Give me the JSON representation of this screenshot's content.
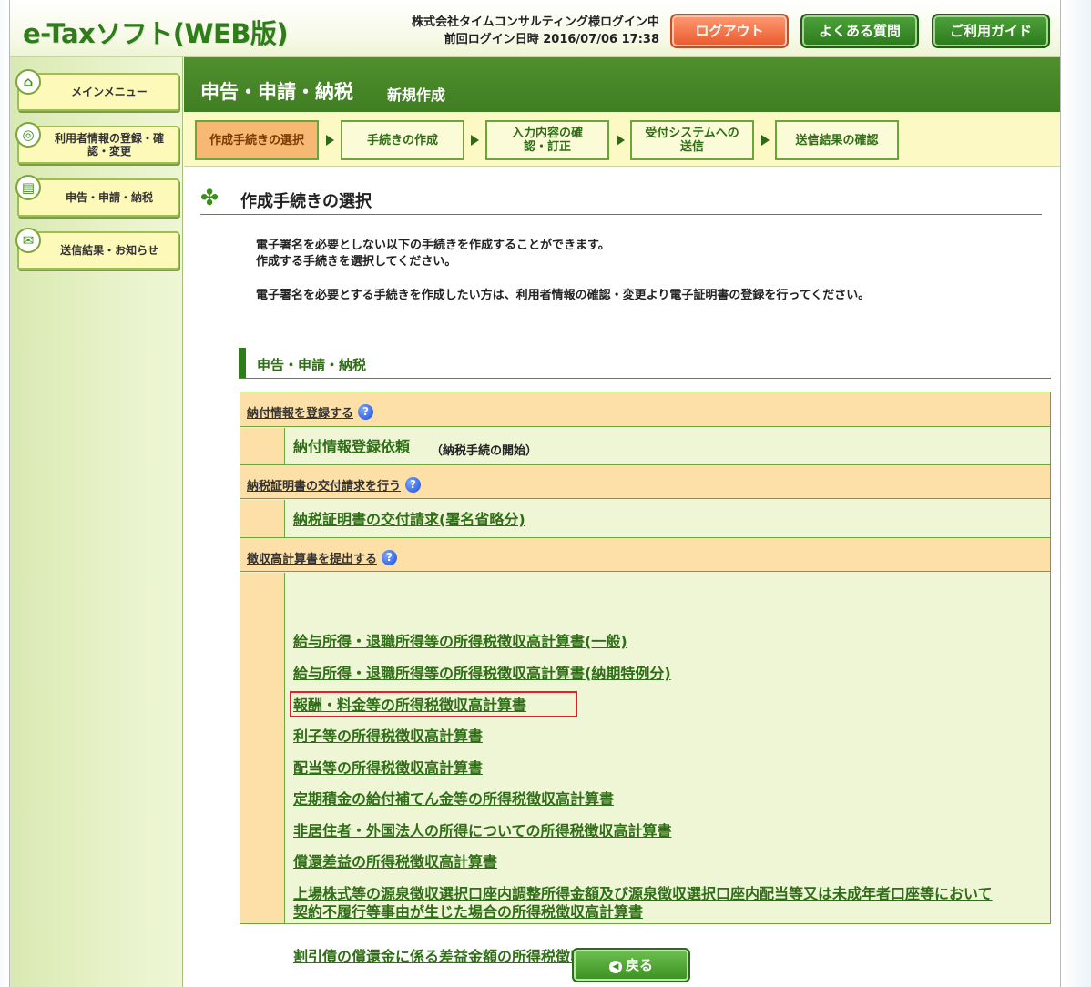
{
  "header": {
    "logo": "e-Taxソフト(WEB版)",
    "login_user": "株式会社タイムコンサルティング様ログイン中",
    "last_login": "前回ログイン日時 2016/07/06 17:38",
    "logout_label": "ログアウト",
    "faq_label": "よくある質問",
    "guide_label": "ご利用ガイド"
  },
  "sidebar": {
    "items": [
      {
        "label": "メインメニュー",
        "icon": "home-icon"
      },
      {
        "label": "利用者情報の登録・確認・変更",
        "icon": "user-info-icon"
      },
      {
        "label": "申告・申請・納税",
        "icon": "document-icon"
      },
      {
        "label": "送信結果・お知らせ",
        "icon": "mail-icon"
      }
    ]
  },
  "page": {
    "title": "申告・申請・納税",
    "subtitle": "新規作成"
  },
  "steps": [
    {
      "label": "作成手続きの選択",
      "active": true
    },
    {
      "label": "手続きの作成",
      "active": false
    },
    {
      "label": "入力内容の確認・訂正",
      "active": false
    },
    {
      "label": "受付システムへの送信",
      "active": false
    },
    {
      "label": "送信結果の確認",
      "active": false
    }
  ],
  "section": {
    "title": "作成手続きの選択",
    "desc_line1": "電子署名を必要としない以下の手続きを作成することができます。",
    "desc_line2": "作成する手続きを選択してください。",
    "desc_line3": "電子署名を必要とする手続きを作成したい方は、利用者情報の確認・変更より電子証明書の登録を行ってください。",
    "subsection": "申告・申請・納税"
  },
  "groups": [
    {
      "label": "納付情報を登録する",
      "items": [
        {
          "label": "納付情報登録依頼",
          "note": "（納税手続の開始）"
        }
      ]
    },
    {
      "label": "納税証明書の交付請求を行う",
      "items": [
        {
          "label": "納税証明書の交付請求(署名省略分)"
        }
      ]
    },
    {
      "label": "徴収高計算書を提出する",
      "items": [
        {
          "label": "給与所得・退職所得等の所得税徴収高計算書(一般)"
        },
        {
          "label": "給与所得・退職所得等の所得税徴収高計算書(納期特例分)"
        },
        {
          "label": "報酬・料金等の所得税徴収高計算書"
        },
        {
          "label": "利子等の所得税徴収高計算書"
        },
        {
          "label": "配当等の所得税徴収高計算書"
        },
        {
          "label": "定期積金の給付補てん金等の所得税徴収高計算書"
        },
        {
          "label": "非居住者・外国法人の所得についての所得税徴収高計算書"
        },
        {
          "label": "償還差益の所得税徴収高計算書"
        },
        {
          "label": "上場株式等の源泉徴収選択口座内調整所得金額及び源泉徴収選択口座内配当等又は未成年者口座等において",
          "label2": "契約不履行等事由が生じた場合の所得税徴収高計算書"
        },
        {
          "label": "割引債の償還金に係る差益金額の所得税徴収高計算書"
        }
      ]
    }
  ],
  "back_label": "戻る",
  "accent_color": "#4f8f2e",
  "highlight_color": "#e0202a"
}
